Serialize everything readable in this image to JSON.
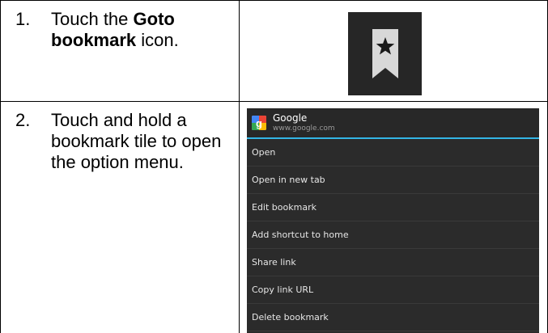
{
  "steps": [
    {
      "number": "1.",
      "text_before": "Touch the ",
      "bold": "Goto bookmark",
      "text_after": " icon."
    },
    {
      "number": "2.",
      "text": "Touch and hold a bookmark tile to open the option menu."
    }
  ],
  "bookmark_icon": {
    "icon": "goto-bookmark-icon",
    "background": "#262626",
    "ribbon_color": "#d8d8d8",
    "star_color": "#1a1a1a"
  },
  "context_menu": {
    "title": "Google",
    "url": "www.google.com",
    "accent": "#33b5e5",
    "logo_icon": "google-logo-icon",
    "items": [
      "Open",
      "Open in new tab",
      "Edit bookmark",
      "Add shortcut to home",
      "Share link",
      "Copy link URL",
      "Delete bookmark"
    ]
  }
}
